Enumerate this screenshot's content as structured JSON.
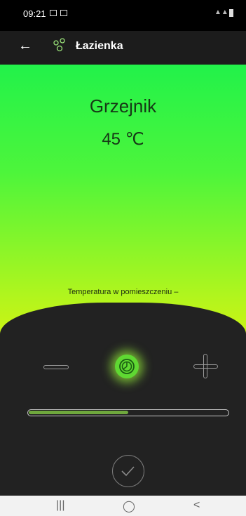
{
  "status_bar": {
    "time": "09:21"
  },
  "app_bar": {
    "back_glyph": "←",
    "title": "Łazienka"
  },
  "device": {
    "name": "Grzejnik",
    "setpoint": "45 ℃",
    "room_temperature_label": "Temperatura w pomieszczeniu –"
  },
  "slider": {
    "level_fraction": 0.5
  },
  "nav_bar": {
    "recents": "|||",
    "home": "◯",
    "back": "<"
  },
  "colors": {
    "accent": "#5fd832",
    "panel": "#222222",
    "gradient_top": "#22f24a",
    "gradient_bottom": "#f0f106"
  },
  "icons": [
    "back-arrow-icon",
    "room-icon",
    "minus-icon",
    "mode-icon",
    "plus-icon",
    "confirm-icon"
  ]
}
